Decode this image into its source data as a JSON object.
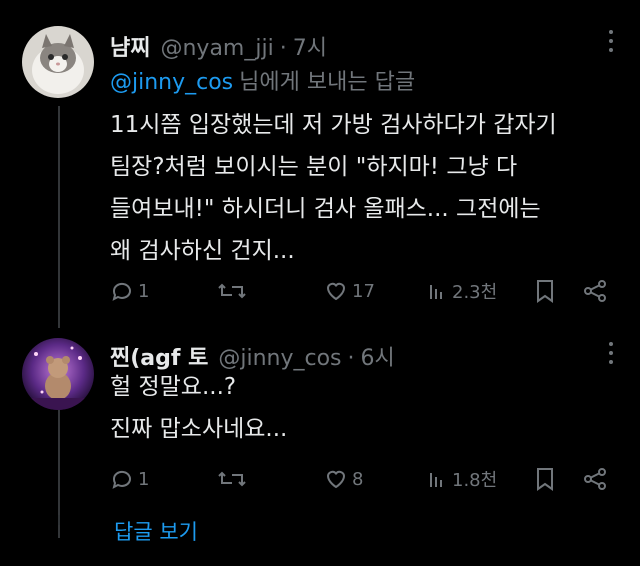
{
  "tweets": [
    {
      "name": "냠찌",
      "handle": "@nyam_jji",
      "dot": "·",
      "time": "7시",
      "reply_to": {
        "mention": "@jinny_cos",
        "suffix": "님에게 보내는 답글"
      },
      "lines": [
        "11시쯤 입장했는데 저 가방 검사하다가 갑자기",
        "팀장?처럼 보이시는 분이 \"하지마! 그냥 다",
        "들여보내!\" 하시더니 검사 올패스... 그전에는",
        "왜 검사하신 건지..."
      ],
      "stats": {
        "replies": "1",
        "retweets": "",
        "likes": "17",
        "views": "2.3천"
      }
    },
    {
      "name": "찐(agf 토",
      "handle": "@jinny_cos",
      "dot": "·",
      "time": "6시",
      "lines": [
        "헐 정말요...?",
        "진짜 맙소사네요..."
      ],
      "stats": {
        "replies": "1",
        "retweets": "",
        "likes": "8",
        "views": "1.8천"
      }
    }
  ],
  "show_replies_label": "답글 보기",
  "colors": {
    "background": "#000000",
    "text": "#e7e9ea",
    "muted": "#71767b",
    "accent": "#1d9bf0"
  },
  "icons": [
    "reply-icon",
    "retweet-icon",
    "like-icon",
    "views-icon",
    "bookmark-icon",
    "share-icon",
    "more-icon"
  ]
}
